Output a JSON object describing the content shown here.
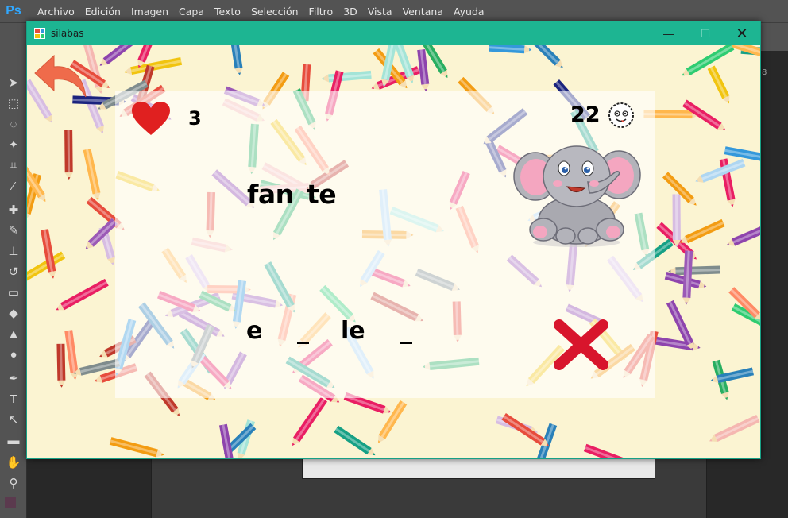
{
  "photoshop": {
    "logo": "Ps",
    "menu": [
      "Archivo",
      "Edición",
      "Imagen",
      "Capa",
      "Texto",
      "Selección",
      "Filtro",
      "3D",
      "Vista",
      "Ventana",
      "Ayuda"
    ]
  },
  "window": {
    "title": "silabas",
    "minimize_glyph": "—",
    "maximize_glyph": "☐",
    "close_glyph": "✕"
  },
  "game": {
    "back_icon": "back-arrow-icon",
    "lives_icon": "heart-icon",
    "lives": "3",
    "timer": "22",
    "timer_icon": "clock-icon",
    "image_label": "elephant",
    "syllables": [
      "fan",
      "te"
    ],
    "answer_slots": [
      "e",
      "_",
      "le",
      "_"
    ],
    "status_icon": "wrong-mark-icon",
    "colors": {
      "title_bar": "#1db592",
      "background": "#fbf4d2",
      "heart": "#e02020",
      "arrow": "#ef6b4b",
      "wrong_mark": "#d8152c"
    }
  }
}
